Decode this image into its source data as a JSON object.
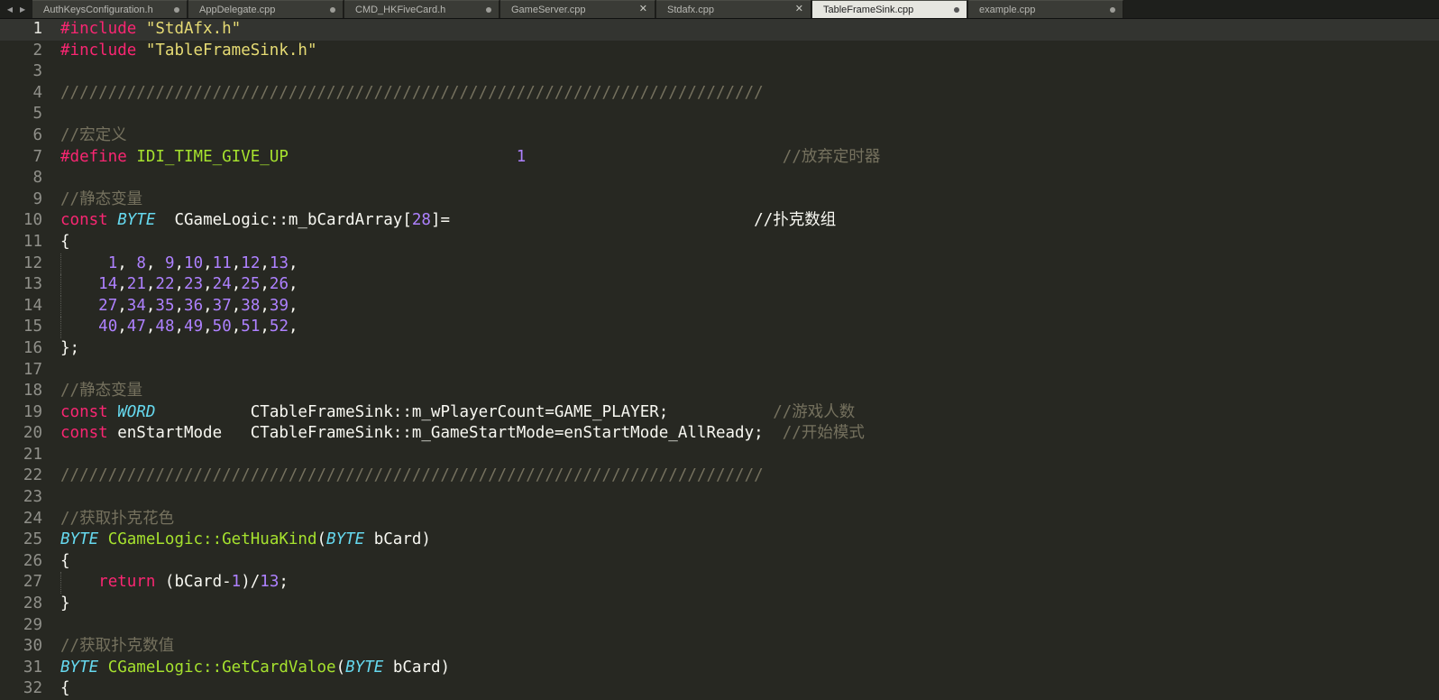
{
  "tabs": [
    {
      "label": "AuthKeysConfiguration.h",
      "state": "modified"
    },
    {
      "label": "AppDelegate.cpp",
      "state": "modified"
    },
    {
      "label": "CMD_HKFiveCard.h",
      "state": "modified"
    },
    {
      "label": "GameServer.cpp",
      "state": "close"
    },
    {
      "label": "Stdafx.cpp",
      "state": "close"
    },
    {
      "label": "TableFrameSink.cpp",
      "state": "modified",
      "active": true
    },
    {
      "label": "example.cpp",
      "state": "modified"
    }
  ],
  "syntax_colors": {
    "background": "#272822",
    "keyword": "#f92672",
    "string": "#e6db74",
    "comment": "#75715e",
    "type": "#66d9ef",
    "number": "#ae81ff",
    "function": "#a6e22e"
  },
  "current_line": 1,
  "lines": [
    [
      [
        "k",
        "#include"
      ],
      [
        "p",
        " "
      ],
      [
        "s",
        "\"StdAfx.h\""
      ]
    ],
    [
      [
        "k",
        "#include"
      ],
      [
        "p",
        " "
      ],
      [
        "s",
        "\"TableFrameSink.h\""
      ]
    ],
    [],
    [
      [
        "c",
        "//////////////////////////////////////////////////////////////////////////"
      ]
    ],
    [],
    [
      [
        "c",
        "//宏定义"
      ]
    ],
    [
      [
        "k",
        "#define"
      ],
      [
        "p",
        " "
      ],
      [
        "f",
        "IDI_TIME_GIVE_UP"
      ],
      [
        "p",
        "                        "
      ],
      [
        "n",
        "1"
      ],
      [
        "p",
        "                           "
      ],
      [
        "c",
        "//放弃定时器"
      ]
    ],
    [],
    [
      [
        "c",
        "//静态变量"
      ]
    ],
    [
      [
        "k",
        "const"
      ],
      [
        "p",
        " "
      ],
      [
        "t",
        "BYTE"
      ],
      [
        "p",
        "  CGameLogic::m_bCardArray["
      ],
      [
        "n",
        "28"
      ],
      [
        "p",
        "]=                                //扑克数组"
      ]
    ],
    [
      [
        "p",
        "{"
      ]
    ],
    [
      [
        "p",
        "     "
      ],
      [
        "n",
        "1"
      ],
      [
        "p",
        ", "
      ],
      [
        "n",
        "8"
      ],
      [
        "p",
        ", "
      ],
      [
        "n",
        "9"
      ],
      [
        "p",
        ","
      ],
      [
        "n",
        "10"
      ],
      [
        "p",
        ","
      ],
      [
        "n",
        "11"
      ],
      [
        "p",
        ","
      ],
      [
        "n",
        "12"
      ],
      [
        "p",
        ","
      ],
      [
        "n",
        "13"
      ],
      [
        "p",
        ","
      ]
    ],
    [
      [
        "p",
        "    "
      ],
      [
        "n",
        "14"
      ],
      [
        "p",
        ","
      ],
      [
        "n",
        "21"
      ],
      [
        "p",
        ","
      ],
      [
        "n",
        "22"
      ],
      [
        "p",
        ","
      ],
      [
        "n",
        "23"
      ],
      [
        "p",
        ","
      ],
      [
        "n",
        "24"
      ],
      [
        "p",
        ","
      ],
      [
        "n",
        "25"
      ],
      [
        "p",
        ","
      ],
      [
        "n",
        "26"
      ],
      [
        "p",
        ","
      ]
    ],
    [
      [
        "p",
        "    "
      ],
      [
        "n",
        "27"
      ],
      [
        "p",
        ","
      ],
      [
        "n",
        "34"
      ],
      [
        "p",
        ","
      ],
      [
        "n",
        "35"
      ],
      [
        "p",
        ","
      ],
      [
        "n",
        "36"
      ],
      [
        "p",
        ","
      ],
      [
        "n",
        "37"
      ],
      [
        "p",
        ","
      ],
      [
        "n",
        "38"
      ],
      [
        "p",
        ","
      ],
      [
        "n",
        "39"
      ],
      [
        "p",
        ","
      ]
    ],
    [
      [
        "p",
        "    "
      ],
      [
        "n",
        "40"
      ],
      [
        "p",
        ","
      ],
      [
        "n",
        "47"
      ],
      [
        "p",
        ","
      ],
      [
        "n",
        "48"
      ],
      [
        "p",
        ","
      ],
      [
        "n",
        "49"
      ],
      [
        "p",
        ","
      ],
      [
        "n",
        "50"
      ],
      [
        "p",
        ","
      ],
      [
        "n",
        "51"
      ],
      [
        "p",
        ","
      ],
      [
        "n",
        "52"
      ],
      [
        "p",
        ","
      ]
    ],
    [
      [
        "p",
        "};"
      ]
    ],
    [],
    [
      [
        "c",
        "//静态变量"
      ]
    ],
    [
      [
        "k",
        "const"
      ],
      [
        "p",
        " "
      ],
      [
        "t",
        "WORD"
      ],
      [
        "p",
        "          CTableFrameSink::m_wPlayerCount=GAME_PLAYER;           "
      ],
      [
        "c",
        "//游戏人数"
      ]
    ],
    [
      [
        "k",
        "const"
      ],
      [
        "p",
        " enStartMode   CTableFrameSink::m_GameStartMode=enStartMode_AllReady;  "
      ],
      [
        "c",
        "//开始模式"
      ]
    ],
    [],
    [
      [
        "c",
        "//////////////////////////////////////////////////////////////////////////"
      ]
    ],
    [],
    [
      [
        "c",
        "//获取扑克花色"
      ]
    ],
    [
      [
        "t",
        "BYTE"
      ],
      [
        "p",
        " "
      ],
      [
        "f",
        "CGameLogic::GetHuaKind"
      ],
      [
        "p",
        "("
      ],
      [
        "t",
        "BYTE"
      ],
      [
        "p",
        " bCard)"
      ]
    ],
    [
      [
        "p",
        "{"
      ]
    ],
    [
      [
        "p",
        "    "
      ],
      [
        "k",
        "return"
      ],
      [
        "p",
        " (bCard-"
      ],
      [
        "n",
        "1"
      ],
      [
        "p",
        ")/"
      ],
      [
        "n",
        "13"
      ],
      [
        "p",
        ";"
      ]
    ],
    [
      [
        "p",
        "}"
      ]
    ],
    [],
    [
      [
        "c",
        "//获取扑克数值"
      ]
    ],
    [
      [
        "t",
        "BYTE"
      ],
      [
        "p",
        " "
      ],
      [
        "f",
        "CGameLogic::GetCardValoe"
      ],
      [
        "p",
        "("
      ],
      [
        "t",
        "BYTE"
      ],
      [
        "p",
        " bCard)"
      ]
    ],
    [
      [
        "p",
        "{"
      ]
    ]
  ]
}
